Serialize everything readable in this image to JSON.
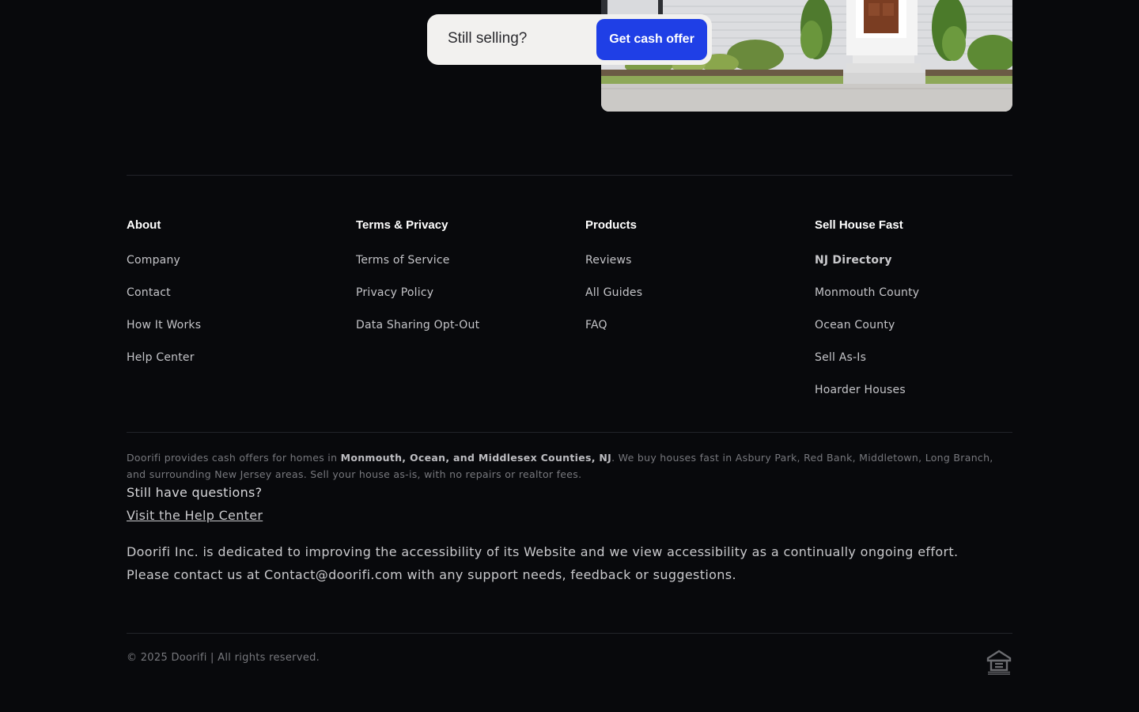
{
  "cta": {
    "text": "Still selling?",
    "button_label": "Get cash offer"
  },
  "columns": [
    {
      "title": "About",
      "links": [
        "Company",
        "Contact",
        "How It Works",
        "Help Center"
      ]
    },
    {
      "title": "Terms & Privacy",
      "links": [
        "Terms of Service",
        "Privacy Policy",
        "Data Sharing Opt-Out"
      ]
    },
    {
      "title": "Products",
      "links": [
        "Reviews",
        "All Guides",
        "FAQ"
      ]
    },
    {
      "title": "Sell House Fast",
      "links": [
        "NJ Directory",
        "Monmouth County",
        "Ocean County",
        "Sell As-Is",
        "Hoarder Houses"
      ]
    }
  ],
  "description": {
    "prefix": "Doorifi provides cash offers for homes in ",
    "bold": "Monmouth, Ocean, and Middlesex Counties, NJ",
    "suffix": ". We buy houses fast in Asbury Park, Red Bank, Middletown, Long Branch, and surrounding New Jersey areas. Sell your house as-is, with no repairs or realtor fees."
  },
  "help": {
    "question": "Still have questions?",
    "link": "Visit the Help Center"
  },
  "accessibility": "Doorifi Inc. is dedicated to improving the accessibility of its Website and we view accessibility as a continually ongoing effort. Please contact us at Contact@doorifi.com with any support needs, feedback or suggestions.",
  "copyright": "© 2025 Doorifi | All rights reserved.",
  "icons": {
    "equal_housing": "equal-housing-opportunity-icon"
  },
  "colors": {
    "background": "#08090c",
    "accent": "#1f3fe6"
  }
}
